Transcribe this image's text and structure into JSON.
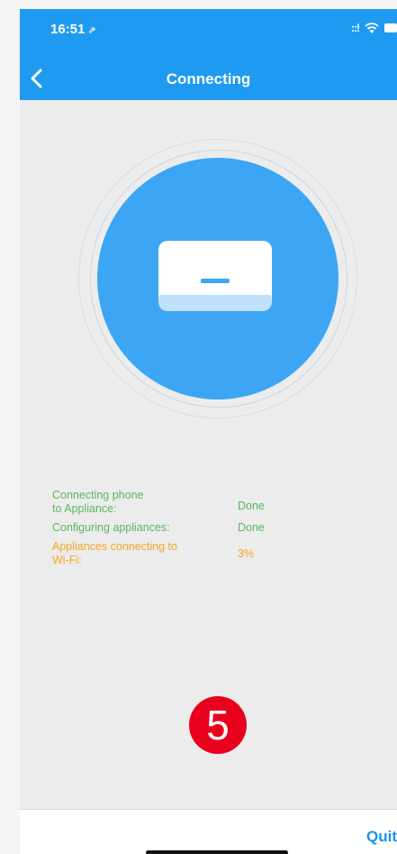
{
  "status_bar": {
    "time": "16:51",
    "location_arrow": "⇗",
    "signal": "::!"
  },
  "header": {
    "title": "Connecting",
    "back_icon": "chevron-left-icon"
  },
  "device": {
    "icon": "air-conditioner-icon"
  },
  "progress": {
    "items": [
      {
        "label": "Connecting phone to Appliance:",
        "label_line1": "Connecting phone",
        "label_line2": "to Appliance:",
        "status": "Done",
        "color": "#58b860"
      },
      {
        "label": "Configuring appliances:",
        "status": "Done",
        "color": "#58b860"
      },
      {
        "label": "Appliances connecting to Wi-Fi:",
        "label_line1": "Appliances connecting to",
        "label_line2": "Wi-Fi:",
        "status": "3%",
        "color": "#f5a623"
      }
    ]
  },
  "step_marker": {
    "number": "5",
    "color": "#e8001c"
  },
  "footer": {
    "quit_label": "Quit"
  },
  "colors": {
    "accent": "#1e9bf0",
    "circle": "#3ca6f4"
  }
}
